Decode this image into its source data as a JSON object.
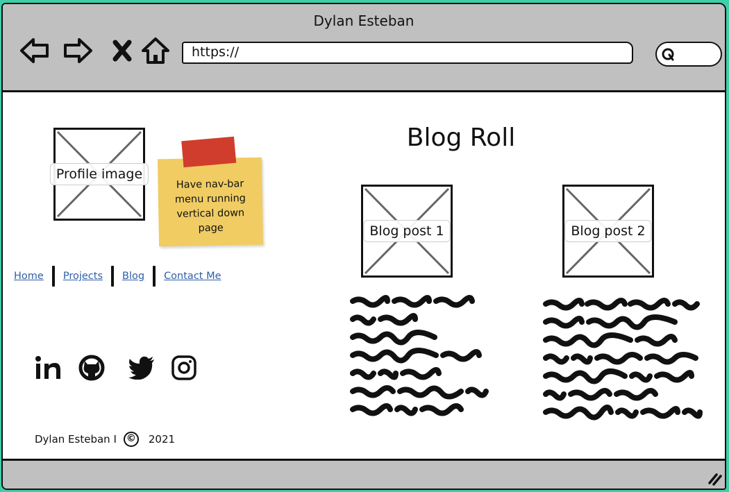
{
  "window": {
    "title": "Dylan Esteban"
  },
  "toolbar": {
    "back_icon": "back-arrow-icon",
    "forward_icon": "forward-arrow-icon",
    "stop_icon": "close-icon",
    "home_icon": "home-icon",
    "url": "https://",
    "search_icon": "search-icon"
  },
  "profile": {
    "image_label": "Profile image"
  },
  "note": {
    "text": "Have nav-bar menu running vertical down page"
  },
  "nav": {
    "items": [
      {
        "label": "Home"
      },
      {
        "label": "Projects"
      },
      {
        "label": "Blog"
      },
      {
        "label": "Contact Me"
      }
    ],
    "link_color": "#2d5fa8"
  },
  "social": {
    "icons": [
      "linkedin-icon",
      "github-icon",
      "twitter-icon",
      "instagram-icon"
    ]
  },
  "footer": {
    "name": "Dylan Esteban I",
    "copyright_icon": "©",
    "year": "2021"
  },
  "blog": {
    "title": "Blog Roll",
    "posts": [
      {
        "image_label": "Blog post 1"
      },
      {
        "image_label": "Blog post 2"
      }
    ]
  },
  "colors": {
    "background": "#3fcfa8",
    "chrome": "#c0c0c0",
    "sticky": "#f0cc63",
    "tape": "#d03d2c"
  }
}
